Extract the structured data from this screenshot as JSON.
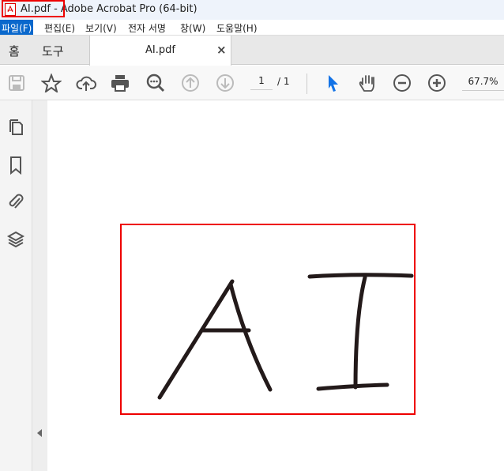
{
  "window": {
    "title": "AI.pdf - Adobe Acrobat Pro (64-bit)"
  },
  "menu": [
    "파일(F)",
    "편집(E)",
    "보기(V)",
    "전자 서명",
    "창(W)",
    "도움말(H)"
  ],
  "tabs": {
    "home": "홈",
    "tools": "도구",
    "document": "AI.pdf",
    "close": "×"
  },
  "toolbar": {
    "page_current": "1",
    "page_total": "/ 1",
    "zoom": "67.7%"
  },
  "document": {
    "drawn_text": "AI"
  },
  "colors": {
    "highlight": "#e00000",
    "accent": "#0a68cc",
    "select_tool": "#1473e6"
  }
}
